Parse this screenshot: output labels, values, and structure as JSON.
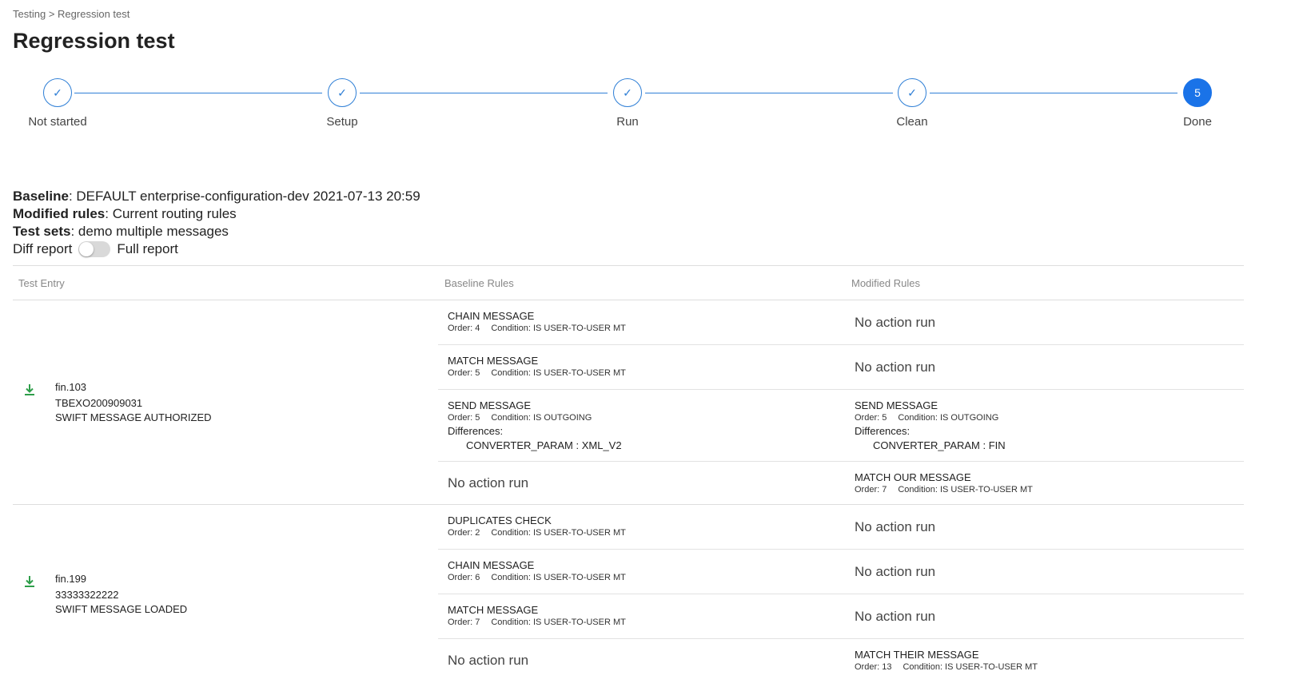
{
  "breadcrumb": {
    "parent": "Testing",
    "separator": ">",
    "current": "Regression test"
  },
  "page_title": "Regression test",
  "stepper": {
    "steps": [
      {
        "label": "Not started",
        "state": "done",
        "icon": "check-icon"
      },
      {
        "label": "Setup",
        "state": "done",
        "icon": "check-icon"
      },
      {
        "label": "Run",
        "state": "done",
        "icon": "check-icon"
      },
      {
        "label": "Clean",
        "state": "done",
        "icon": "check-icon"
      },
      {
        "label": "Done",
        "state": "active",
        "number": "5"
      }
    ],
    "accent_color": "#1a73e8"
  },
  "info": {
    "baseline_label": "Baseline",
    "baseline_value": "DEFAULT enterprise-configuration-dev 2021-07-13 20:59",
    "modified_label": "Modified rules",
    "modified_value": "Current routing rules",
    "testsets_label": "Test sets",
    "testsets_value": "demo multiple messages",
    "diff_report_label": "Diff report",
    "full_report_label": "Full report",
    "toggle_on": false
  },
  "table": {
    "headers": {
      "entry": "Test Entry",
      "baseline": "Baseline Rules",
      "modified": "Modified Rules"
    },
    "no_action_text": "No action run",
    "entries": [
      {
        "name": "fin.103",
        "reference": "TBEXO200909031",
        "status": "SWIFT MESSAGE AUTHORIZED",
        "rows": [
          {
            "baseline": {
              "name": "CHAIN MESSAGE",
              "order": "Order: 4",
              "condition": "Condition: IS USER-TO-USER MT"
            },
            "modified": null
          },
          {
            "baseline": {
              "name": "MATCH MESSAGE",
              "order": "Order: 5",
              "condition": "Condition: IS USER-TO-USER MT"
            },
            "modified": null
          },
          {
            "baseline": {
              "name": "SEND MESSAGE",
              "order": "Order: 5",
              "condition": "Condition: IS OUTGOING",
              "differences_label": "Differences:",
              "difference": "CONVERTER_PARAM : XML_V2"
            },
            "modified": {
              "name": "SEND MESSAGE",
              "order": "Order: 5",
              "condition": "Condition: IS OUTGOING",
              "differences_label": "Differences:",
              "difference": "CONVERTER_PARAM : FIN"
            }
          },
          {
            "baseline": null,
            "modified": {
              "name": "MATCH OUR MESSAGE",
              "order": "Order: 7",
              "condition": "Condition: IS USER-TO-USER MT"
            }
          }
        ]
      },
      {
        "name": "fin.199",
        "reference": "33333322222",
        "status": "SWIFT MESSAGE LOADED",
        "rows": [
          {
            "baseline": {
              "name": "DUPLICATES CHECK",
              "order": "Order: 2",
              "condition": "Condition: IS USER-TO-USER MT"
            },
            "modified": null
          },
          {
            "baseline": {
              "name": "CHAIN MESSAGE",
              "order": "Order: 6",
              "condition": "Condition: IS USER-TO-USER MT"
            },
            "modified": null
          },
          {
            "baseline": {
              "name": "MATCH MESSAGE",
              "order": "Order: 7",
              "condition": "Condition: IS USER-TO-USER MT"
            },
            "modified": null
          },
          {
            "baseline": null,
            "modified": {
              "name": "MATCH THEIR MESSAGE",
              "order": "Order: 13",
              "condition": "Condition: IS USER-TO-USER MT"
            }
          }
        ]
      }
    ]
  },
  "colors": {
    "download_icon": "#2e9e4a",
    "step_line": "#2f7fd6"
  }
}
